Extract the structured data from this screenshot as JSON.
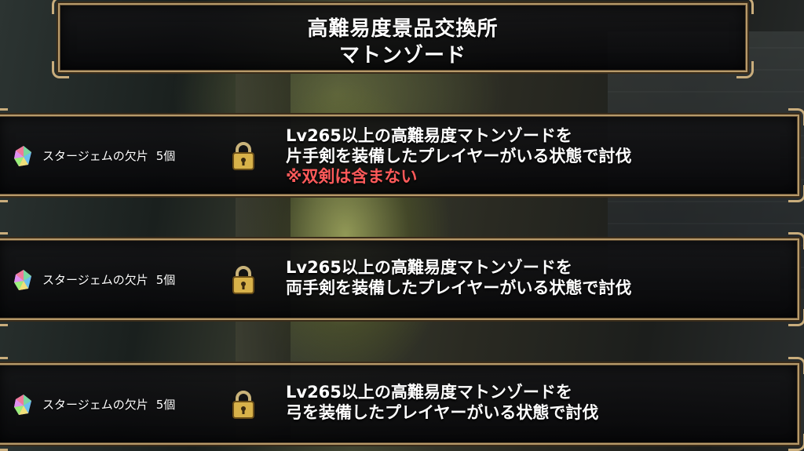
{
  "title": {
    "line1": "高難易度景品交換所",
    "line2": "マトンゾード"
  },
  "colors": {
    "frame_gold": "#b79a6a",
    "note_red": "#ff5a5a"
  },
  "items": [
    {
      "reward_icon": "star-gem-fragment-icon",
      "reward_name": "スタージェムの欠片",
      "reward_count": "5個",
      "status_icon": "padlock-icon",
      "condition_line1": "Lv265以上の高難易度マトンゾードを",
      "condition_line2": "片手剣を装備したプレイヤーがいる状態で討伐",
      "note": "※双剣は含まない"
    },
    {
      "reward_icon": "star-gem-fragment-icon",
      "reward_name": "スタージェムの欠片",
      "reward_count": "5個",
      "status_icon": "padlock-icon",
      "condition_line1": "Lv265以上の高難易度マトンゾードを",
      "condition_line2": "両手剣を装備したプレイヤーがいる状態で討伐"
    },
    {
      "reward_icon": "star-gem-fragment-icon",
      "reward_name": "スタージェムの欠片",
      "reward_count": "5個",
      "status_icon": "padlock-icon",
      "condition_line1": "Lv265以上の高難易度マトンゾードを",
      "condition_line2": "弓を装備したプレイヤーがいる状態で討伐"
    }
  ]
}
